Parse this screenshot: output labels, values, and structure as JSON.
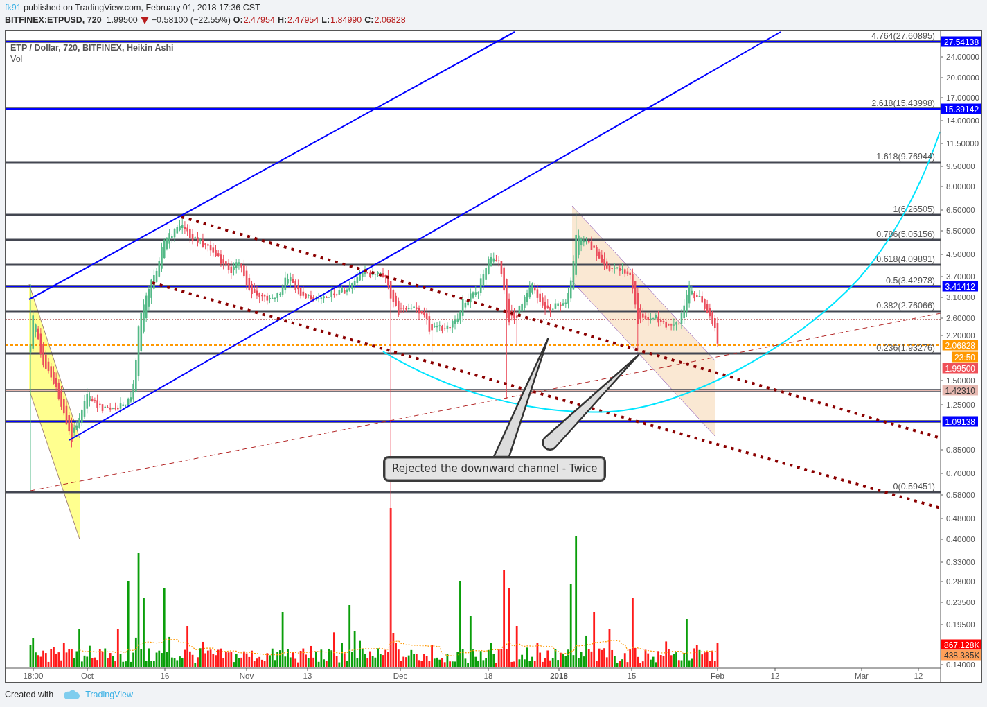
{
  "header": {
    "author": "fk91",
    "publish_note": "published on TradingView.com, February 01, 2018 17:36 CST"
  },
  "quote": {
    "symbol": "BITFINEX:ETPUSD, 720",
    "last": "1.99500",
    "price_down": true,
    "change": "−0.58100 (−22.55%)",
    "ohlc": [
      {
        "label": "O:",
        "value": "2.47954"
      },
      {
        "label": "H:",
        "value": "2.47954"
      },
      {
        "label": "L:",
        "value": "1.84990"
      },
      {
        "label": "C:",
        "value": "2.06828"
      }
    ]
  },
  "chart": {
    "legend": [
      "ETP / Dollar, 720, BITFINEX, Heikin Ashi",
      "Vol"
    ],
    "fib_levels": [
      "4.764(27.60895)",
      "2.618(15.43998)",
      "1.618(9.76944)",
      "1(6.26505)",
      "0.786(5.05156)",
      "0.618(4.09891)",
      "0.5(3.42978)",
      "0.382(2.76066)",
      "0.236(1.93276)",
      "0(0.59451)"
    ],
    "price_axis": [
      "24.00000",
      "20.00000",
      "17.00000",
      "14.00000",
      "11.50000",
      "9.50000",
      "8.00000",
      "6.50000",
      "5.50000",
      "4.50000",
      "3.70000",
      "3.10000",
      "2.60000",
      "2.20000",
      "1.50000",
      "1.25000",
      "0.85000",
      "0.70000",
      "0.58000",
      "0.48000",
      "0.40000",
      "0.33000",
      "0.28000",
      "0.23500",
      "0.19500",
      "0.14000"
    ],
    "price_tags": [
      {
        "text": "27.54138",
        "color": "#0000ff",
        "kind": "level"
      },
      {
        "text": "15.39142",
        "color": "#0000ff",
        "kind": "level"
      },
      {
        "text": "3.41412",
        "color": "#0000ff",
        "kind": "level"
      },
      {
        "text": "2.06828",
        "color": "#ff9800",
        "kind": "last"
      },
      {
        "text": "23:50",
        "color": "#ff9800",
        "kind": "plain"
      },
      {
        "text": "1.99500",
        "color": "#ef5058",
        "kind": "plain"
      },
      {
        "text": "1.42310",
        "color": "#e6b8b0",
        "kind": "level"
      },
      {
        "text": "1.09138",
        "color": "#0000ff",
        "kind": "level"
      },
      {
        "text": "867.128K",
        "color": "#ff0000",
        "kind": "plain"
      },
      {
        "text": "438.385K",
        "color": "#ffa05a",
        "kind": "plain"
      }
    ],
    "time_axis": [
      {
        "label": "18:00",
        "kind": "tick"
      },
      {
        "label": "Oct",
        "kind": "tick"
      },
      {
        "label": "16",
        "kind": "tick"
      },
      {
        "label": "Nov",
        "kind": "tick"
      },
      {
        "label": "13",
        "kind": "tick"
      },
      {
        "label": "Dec",
        "kind": "tick"
      },
      {
        "label": "18",
        "kind": "tick"
      },
      {
        "label": "2018",
        "kind": "year"
      },
      {
        "label": "15",
        "kind": "tick"
      },
      {
        "label": "Feb",
        "kind": "tick"
      },
      {
        "label": "12",
        "kind": "tick"
      },
      {
        "label": "Mar",
        "kind": "tick"
      },
      {
        "label": "12",
        "kind": "tick"
      }
    ],
    "annotation": "Rejected the downward channel - Twice"
  },
  "footer": {
    "prefix": "Created with",
    "brand": "TradingView"
  }
}
